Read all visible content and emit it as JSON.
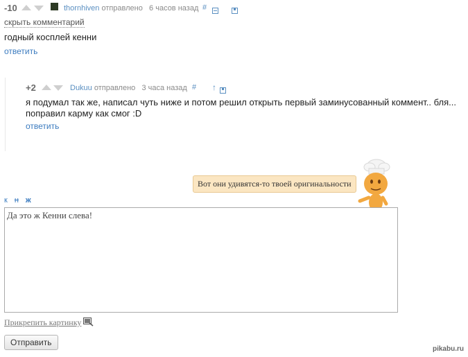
{
  "comment1": {
    "rating": "-10",
    "author": "thornhiven",
    "sent_label": "отправлено",
    "time": "6 часов назад",
    "hash": "#",
    "hide_label": "скрыть комментарий",
    "body": "годный косплей кенни",
    "reply_label": "ответить"
  },
  "comment2": {
    "rating": "+2",
    "author": "Dukuu",
    "sent_label": "отправлено",
    "time": "3 часа назад",
    "hash": "#",
    "up": "↑",
    "body_line1": "я подумал так же, написал чуть ниже и потом решил открыть первый заминусованный коммент.. бля...",
    "body_line2": "поправил карму как смог :D",
    "reply_label": "ответить"
  },
  "mascot": {
    "bubble_text": "Вот они удивятся-то твоей оригинальности"
  },
  "editor": {
    "bold": "ж",
    "italic": "к",
    "strike": "н",
    "value": "Да это ж Кенни слева!"
  },
  "attach_label": "Прикрепить картинку",
  "submit_label": "Отправить",
  "watermark": "pikabu.ru"
}
